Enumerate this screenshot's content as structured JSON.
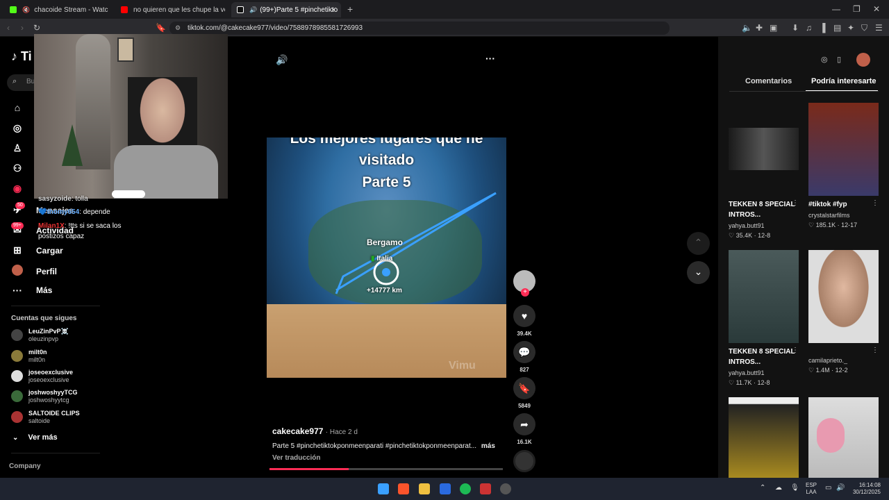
{
  "tabs": [
    {
      "title": "chacoide Stream - Watch Live on"
    },
    {
      "title": "no quieren que les chupe la verga?"
    },
    {
      "title": "(99+)Parte 5 #pinchetiktokpo"
    }
  ],
  "address": {
    "url": "tiktok.com/@cakecake977/video/7588978985581726993"
  },
  "nav": {
    "logo": "Ti",
    "search_placeholder": "Bu",
    "items": [
      {
        "label": "P",
        "icon": "home-icon"
      },
      {
        "label": "E",
        "icon": "explore-icon"
      },
      {
        "label": "S",
        "icon": "following-icon"
      },
      {
        "label": "F",
        "icon": "friends-icon"
      },
      {
        "label": "L",
        "icon": "live-icon"
      },
      {
        "label": "Mensajes",
        "icon": "messages-icon",
        "badge": "50"
      },
      {
        "label": "Actividad",
        "icon": "activity-icon",
        "badge": "99+"
      },
      {
        "label": "Cargar",
        "icon": "upload-icon"
      },
      {
        "label": "Perfil",
        "icon": "profile-icon"
      },
      {
        "label": "Más",
        "icon": "more-icon"
      }
    ],
    "following_title": "Cuentas que sigues",
    "accounts": [
      {
        "name": "LeuZinPvP☠️",
        "user": "oleuzinpvp"
      },
      {
        "name": "milt0n",
        "user": "milt0n"
      },
      {
        "name": "joseoexclusive",
        "user": "joseoexclusive"
      },
      {
        "name": "joshwoshyyTCG",
        "user": "joshwoshyytcg"
      },
      {
        "name": "SALTOIDE CLIPS",
        "user": "saltoide"
      }
    ],
    "see_more": "Ver más",
    "company": "Company"
  },
  "chat": [
    {
      "user": "sasyzoide",
      "text": ": tolla"
    },
    {
      "user": "thomy654",
      "text": ": depende"
    },
    {
      "user": "Milan1X",
      "text": ": !tts si se saca los postizos capaz"
    }
  ],
  "video": {
    "overlay_title_lines": [
      "Los mejores lugares que he",
      "visitado",
      "Parte 5"
    ],
    "map_city": "Bergamo",
    "map_country": "Italia",
    "map_distance": "+14777 km",
    "watermark": "Vimu",
    "author": "cakecake977",
    "time": "· Hace 2 d",
    "caption": "Parte 5 #pinchetiktokponmeenparati #pinchetiktokponmeenparat...",
    "more": "más",
    "translate": "Ver traducción",
    "progress": 0.34
  },
  "actions": {
    "likes": "39.4K",
    "comments": "827",
    "saves": "5849",
    "shares": "16.1K"
  },
  "right": {
    "tab_comments": "Comentarios",
    "tab_interest": "Podría interesarte",
    "cards": [
      {
        "title": "TEKKEN 8 SPECIAL INTROS...",
        "user": "yahya.butt91",
        "likes": "35.4K",
        "date": "12-8"
      },
      {
        "title": "#tiktok #fyp",
        "user": "crystalstarfilms",
        "likes": "185.1K",
        "date": "12-17"
      },
      {
        "title": "TEKKEN 8 SPECIAL INTROS...",
        "user": "yahya.butt91",
        "likes": "11.7K",
        "date": "12-8"
      },
      {
        "title": "",
        "user": "camilaprieto._",
        "likes": "1.4M",
        "date": "12-2"
      }
    ]
  },
  "taskbar": {
    "lang1": "ESP",
    "lang2": "LAA",
    "time": "16:14:08",
    "date": "30/12/2025"
  },
  "colors": {
    "accent": "#fe2c55",
    "bg": "#000000",
    "panel": "#121212"
  }
}
